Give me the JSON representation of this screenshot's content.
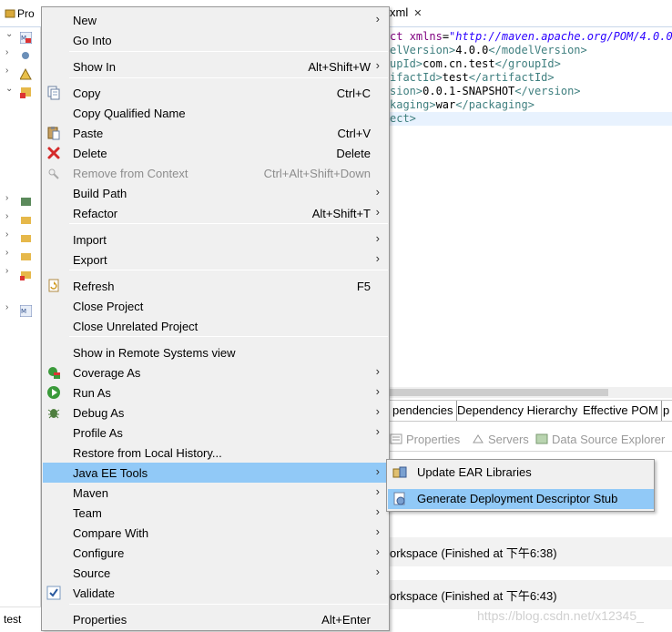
{
  "project_explorer": {
    "tab_label": "Pro",
    "bottom_item": "test"
  },
  "editor": {
    "tab_label": "xml",
    "close_glyph": "✕",
    "code_lines": [
      {
        "parts": [
          {
            "cls": "c-attr",
            "t": "ct "
          },
          {
            "cls": "c-attr",
            "t": "xmlns"
          },
          {
            "cls": "c-txt",
            "t": "="
          },
          {
            "cls": "c-str",
            "t": "\"http://maven.apache.org/POM/4.0.0\""
          }
        ]
      },
      {
        "parts": [
          {
            "cls": "c-tag",
            "t": "elVersion>"
          },
          {
            "cls": "c-txt",
            "t": "4.0.0"
          },
          {
            "cls": "c-tag",
            "t": "</modelVersion>"
          }
        ]
      },
      {
        "parts": [
          {
            "cls": "c-tag",
            "t": "upId>"
          },
          {
            "cls": "c-txt",
            "t": "com.cn.test"
          },
          {
            "cls": "c-tag",
            "t": "</groupId>"
          }
        ]
      },
      {
        "parts": [
          {
            "cls": "c-tag",
            "t": "ifactId>"
          },
          {
            "cls": "c-txt",
            "t": "test"
          },
          {
            "cls": "c-tag",
            "t": "</artifactId>"
          }
        ]
      },
      {
        "parts": [
          {
            "cls": "c-tag",
            "t": "sion>"
          },
          {
            "cls": "c-txt",
            "t": "0.0.1-SNAPSHOT"
          },
          {
            "cls": "c-tag",
            "t": "</version>"
          }
        ]
      },
      {
        "parts": [
          {
            "cls": "c-tag",
            "t": "kaging>"
          },
          {
            "cls": "c-txt",
            "t": "war"
          },
          {
            "cls": "c-tag",
            "t": "</packaging>"
          }
        ]
      },
      {
        "parts": [
          {
            "cls": "c-tag",
            "t": "ect>"
          }
        ]
      }
    ]
  },
  "pom_tabs": [
    "pendencies",
    "Dependency Hierarchy",
    "Effective POM",
    "p"
  ],
  "view_tabs": [
    "Properties",
    "Servers",
    "Data Source Explorer"
  ],
  "console": {
    "line1": "orkspace (Finished at 下午6:38)",
    "line2": "orkspace (Finished at 下午6:43)"
  },
  "watermark": "https://blog.csdn.net/x12345_",
  "context_menu": {
    "submenu_arrow": "›",
    "check_glyph": "✓",
    "items": [
      {
        "label": "New",
        "shortcut": "",
        "submenu": true
      },
      {
        "label": "Go Into",
        "shortcut": "",
        "submenu": false
      },
      {
        "label": "Show In",
        "shortcut": "Alt+Shift+W",
        "submenu": true
      },
      {
        "label": "Copy",
        "shortcut": "Ctrl+C",
        "submenu": false
      },
      {
        "label": "Copy Qualified Name",
        "shortcut": "",
        "submenu": false
      },
      {
        "label": "Paste",
        "shortcut": "Ctrl+V",
        "submenu": false
      },
      {
        "label": "Delete",
        "shortcut": "Delete",
        "submenu": false
      },
      {
        "label": "Remove from Context",
        "shortcut": "Ctrl+Alt+Shift+Down",
        "submenu": false,
        "disabled": true
      },
      {
        "label": "Build Path",
        "shortcut": "",
        "submenu": true
      },
      {
        "label": "Refactor",
        "shortcut": "Alt+Shift+T",
        "submenu": true
      },
      {
        "label": "Import",
        "shortcut": "",
        "submenu": true
      },
      {
        "label": "Export",
        "shortcut": "",
        "submenu": true
      },
      {
        "label": "Refresh",
        "shortcut": "F5",
        "submenu": false
      },
      {
        "label": "Close Project",
        "shortcut": "",
        "submenu": false
      },
      {
        "label": "Close Unrelated Project",
        "shortcut": "",
        "submenu": false
      },
      {
        "label": "Show in Remote Systems view",
        "shortcut": "",
        "submenu": false
      },
      {
        "label": "Coverage As",
        "shortcut": "",
        "submenu": true
      },
      {
        "label": "Run As",
        "shortcut": "",
        "submenu": true
      },
      {
        "label": "Debug As",
        "shortcut": "",
        "submenu": true
      },
      {
        "label": "Profile As",
        "shortcut": "",
        "submenu": true
      },
      {
        "label": "Restore from Local History...",
        "shortcut": "",
        "submenu": false
      },
      {
        "label": "Java EE Tools",
        "shortcut": "",
        "submenu": true,
        "selected": true
      },
      {
        "label": "Maven",
        "shortcut": "",
        "submenu": true
      },
      {
        "label": "Team",
        "shortcut": "",
        "submenu": true
      },
      {
        "label": "Compare With",
        "shortcut": "",
        "submenu": true
      },
      {
        "label": "Configure",
        "shortcut": "",
        "submenu": true
      },
      {
        "label": "Source",
        "shortcut": "",
        "submenu": true
      },
      {
        "label": "Validate",
        "shortcut": "",
        "submenu": false,
        "checked": true
      },
      {
        "label": "Properties",
        "shortcut": "Alt+Enter",
        "submenu": false
      }
    ]
  },
  "java_ee_submenu": {
    "items": [
      {
        "label": "Update EAR Libraries"
      },
      {
        "label": "Generate Deployment Descriptor Stub",
        "selected": true
      }
    ]
  }
}
